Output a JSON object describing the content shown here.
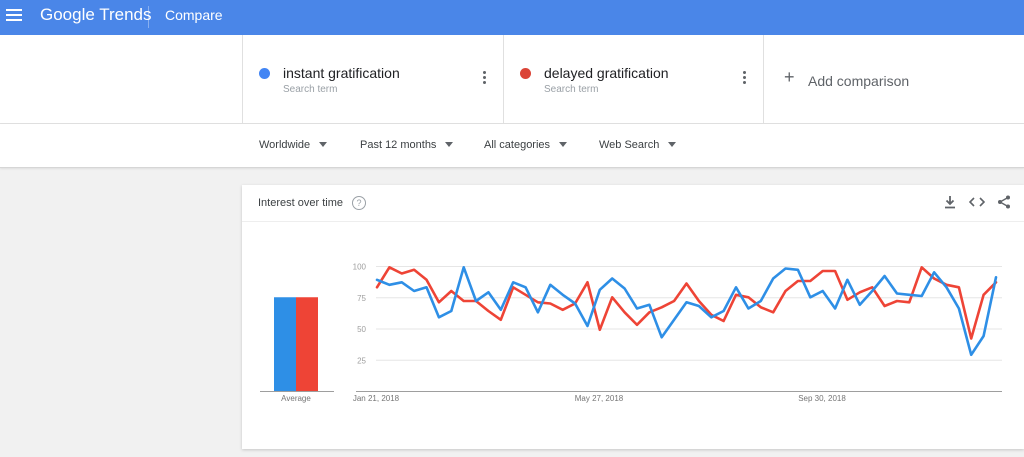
{
  "header": {
    "app_name": "Google Trends",
    "page": "Compare",
    "bar_color": "#4a86e8"
  },
  "terms": [
    {
      "name": "instant gratification",
      "sub": "Search term",
      "color": "#4285f4"
    },
    {
      "name": "delayed gratification",
      "sub": "Search term",
      "color": "#db4437"
    }
  ],
  "add_comparison": "Add comparison",
  "filters": [
    "Worldwide",
    "Past 12 months",
    "All categories",
    "Web Search"
  ],
  "card": {
    "title": "Interest over time",
    "help": "?",
    "icons": [
      "download-icon",
      "embed-icon",
      "share-icon"
    ]
  },
  "chart_data": {
    "type": "line",
    "yticks": [
      100,
      75,
      50,
      25
    ],
    "ylim": [
      0,
      100
    ],
    "xtick_labels": [
      "Jan 21, 2018",
      "May 27, 2018",
      "Sep 30, 2018"
    ],
    "average_label": "Average",
    "averages": [
      {
        "name": "instant gratification",
        "value": 75,
        "color": "#2e8fe6"
      },
      {
        "name": "delayed gratification",
        "value": 75,
        "color": "#ee4436"
      }
    ],
    "series": [
      {
        "name": "instant gratification",
        "color": "#2e8fe6",
        "values": [
          89,
          85,
          87,
          80,
          83,
          59,
          64,
          99,
          72,
          79,
          65,
          87,
          83,
          63,
          85,
          77,
          70,
          52,
          81,
          90,
          82,
          66,
          69,
          43,
          57,
          71,
          68,
          59,
          64,
          83,
          66,
          72,
          90,
          98,
          97,
          75,
          80,
          66,
          89,
          69,
          80,
          92,
          78,
          77,
          76,
          95,
          83,
          66,
          29,
          44,
          91
        ]
      },
      {
        "name": "delayed gratification",
        "color": "#ee4436",
        "values": [
          83,
          99,
          94,
          97,
          89,
          71,
          80,
          72,
          72,
          64,
          57,
          83,
          77,
          71,
          70,
          65,
          70,
          87,
          49,
          75,
          63,
          53,
          63,
          67,
          72,
          86,
          72,
          61,
          56,
          77,
          75,
          67,
          63,
          80,
          88,
          88,
          96,
          96,
          73,
          79,
          83,
          68,
          72,
          71,
          99,
          90,
          85,
          83,
          42,
          77,
          87
        ]
      }
    ]
  }
}
